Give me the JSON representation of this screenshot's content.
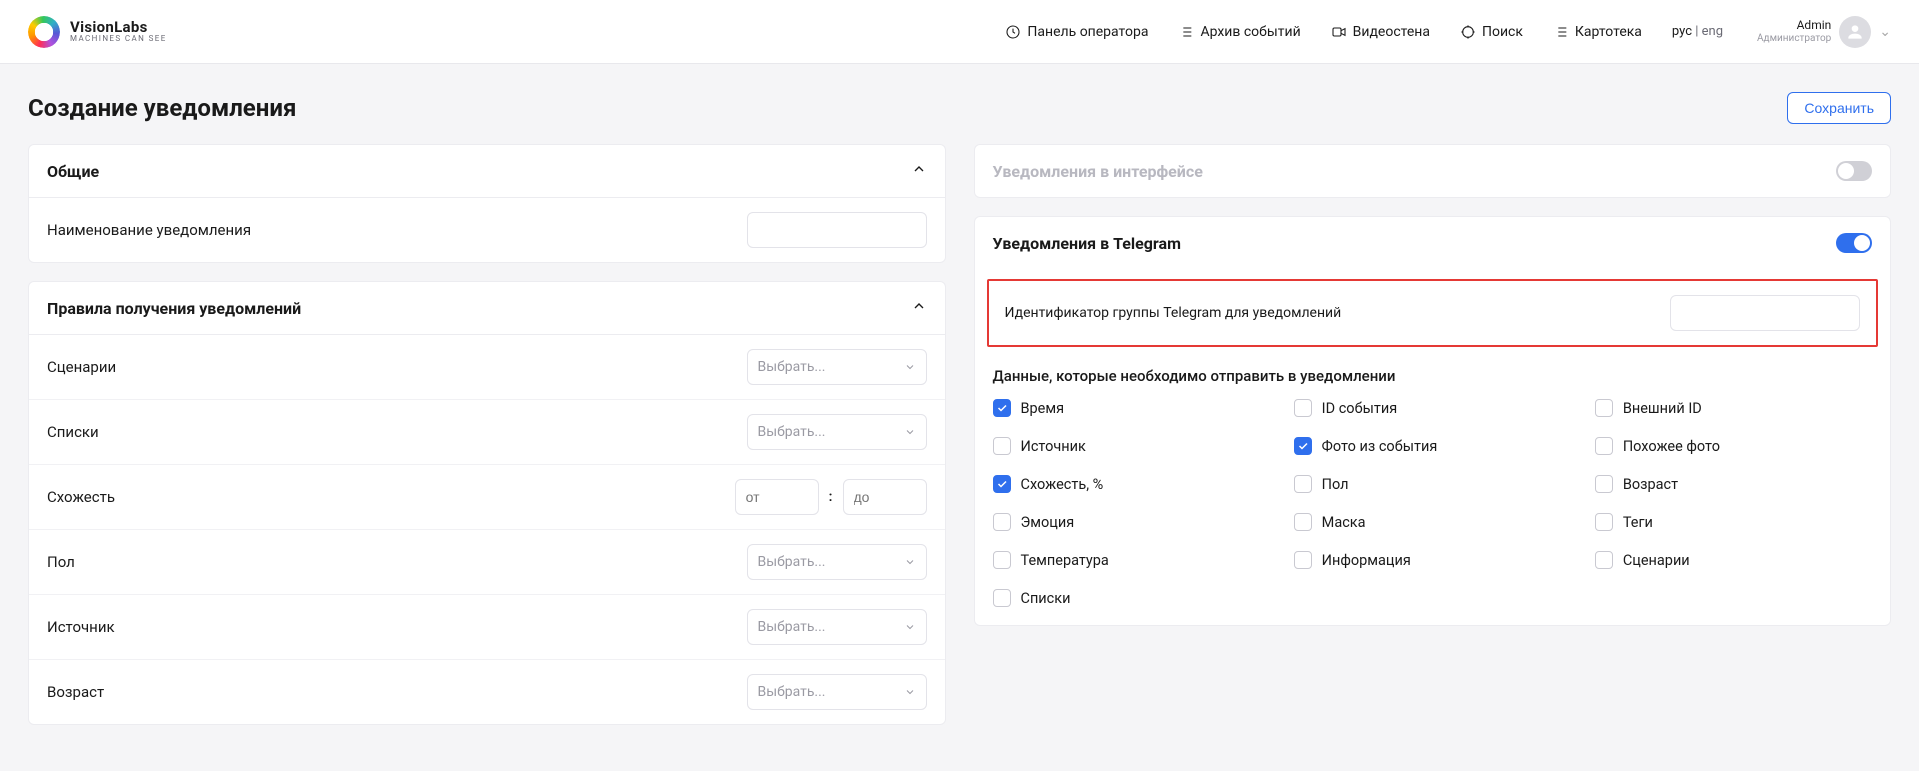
{
  "header": {
    "brand_title": "VisionLabs",
    "brand_sub": "MACHINES CAN SEE",
    "nav": [
      {
        "id": "operator",
        "label": "Панель оператора"
      },
      {
        "id": "archive",
        "label": "Архив событий"
      },
      {
        "id": "videowall",
        "label": "Видеостена"
      },
      {
        "id": "search",
        "label": "Поиск"
      },
      {
        "id": "card-index",
        "label": "Картотека"
      }
    ],
    "lang": {
      "ru": "рус",
      "en": "eng"
    },
    "user": {
      "name": "Admin",
      "role": "Администратор"
    }
  },
  "page": {
    "title": "Создание уведомления",
    "save_label": "Сохранить"
  },
  "general": {
    "title": "Общие",
    "name_label": "Наименование уведомления",
    "name_value": ""
  },
  "rules": {
    "title": "Правила получения уведомлений",
    "select_placeholder": "Выбрать...",
    "rows": {
      "scenarios": "Сценарии",
      "lists": "Списки",
      "similarity": "Схожесть",
      "gender": "Пол",
      "source": "Источник",
      "age": "Возраст"
    },
    "range": {
      "from": "от",
      "to": "до"
    }
  },
  "interface_card": {
    "title": "Уведомления в интерфейсе",
    "enabled": false
  },
  "telegram": {
    "title": "Уведомления в Telegram",
    "enabled": true,
    "group_id_label": "Идентификатор группы Telegram для уведомлений",
    "group_id_value": "",
    "data_title": "Данные, которые необходимо отправить в уведомлении",
    "checkboxes": [
      {
        "id": "time",
        "label": "Время",
        "checked": true
      },
      {
        "id": "event-id",
        "label": "ID события",
        "checked": false
      },
      {
        "id": "external-id",
        "label": "Внешний ID",
        "checked": false
      },
      {
        "id": "source",
        "label": "Источник",
        "checked": false
      },
      {
        "id": "event-photo",
        "label": "Фото из события",
        "checked": true
      },
      {
        "id": "similar-photo",
        "label": "Похожее фото",
        "checked": false
      },
      {
        "id": "similarity",
        "label": "Схожесть, %",
        "checked": true
      },
      {
        "id": "gender",
        "label": "Пол",
        "checked": false
      },
      {
        "id": "age",
        "label": "Возраст",
        "checked": false
      },
      {
        "id": "emotion",
        "label": "Эмоция",
        "checked": false
      },
      {
        "id": "mask",
        "label": "Маска",
        "checked": false
      },
      {
        "id": "tags",
        "label": "Теги",
        "checked": false
      },
      {
        "id": "temperature",
        "label": "Температура",
        "checked": false
      },
      {
        "id": "info",
        "label": "Информация",
        "checked": false
      },
      {
        "id": "scenarios",
        "label": "Сценарии",
        "checked": false
      },
      {
        "id": "lists",
        "label": "Списки",
        "checked": false
      }
    ]
  }
}
